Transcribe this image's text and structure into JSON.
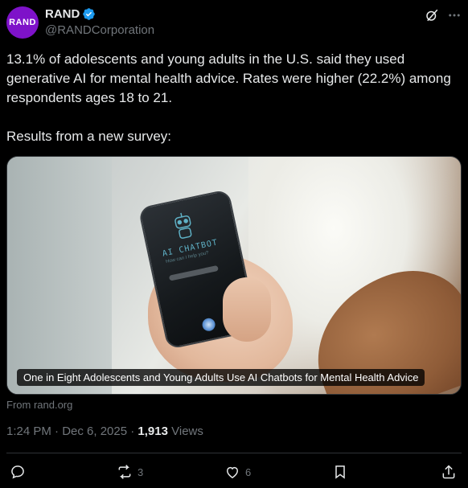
{
  "author": {
    "avatar_text": "RAND",
    "display_name": "RAND",
    "handle": "@RANDCorporation",
    "verified": true
  },
  "tweet": {
    "text": "13.1% of adolescents and young adults in the U.S. said they used generative AI for mental health advice. Rates were higher (22.2%) among respondents ages 18 to 21.\n\nResults from a new survey:"
  },
  "card": {
    "caption": "One in Eight Adolescents and Young Adults Use AI Chatbots for Mental Health Advice",
    "phone_label": "AI CHATBOT",
    "phone_sublabel": "How can I help you?",
    "source": "From rand.org"
  },
  "meta": {
    "time": "1:24 PM · Dec 6, 2025 · ",
    "views_count": "1,913",
    "views_label": " Views"
  },
  "actions": {
    "reposts": "3",
    "likes": "6"
  },
  "colors": {
    "background": "#000000",
    "text": "#e7e9ea",
    "muted": "#71767b",
    "verified": "#1d9bf0",
    "avatar": "#7e12c9"
  },
  "icons": [
    "verified-badge-icon",
    "grok-icon",
    "more-icon",
    "reply-icon",
    "repost-icon",
    "like-icon",
    "bookmark-icon",
    "share-icon",
    "robot-icon"
  ]
}
